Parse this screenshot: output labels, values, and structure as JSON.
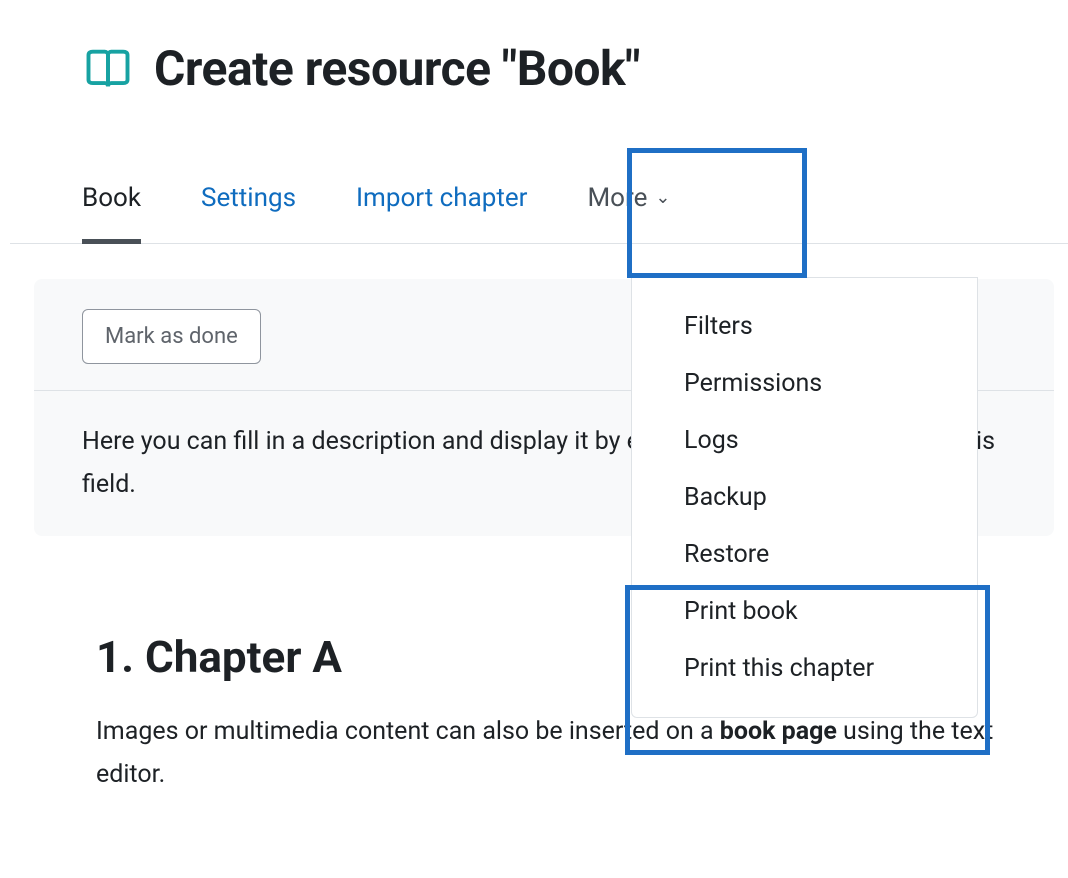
{
  "header": {
    "title": "Create resource \"Book\""
  },
  "tabs": {
    "book": "Book",
    "settings": "Settings",
    "import_chapter": "Import chapter",
    "more": "More"
  },
  "dropdown": {
    "items": [
      "Filters",
      "Permissions",
      "Logs",
      "Backup",
      "Restore",
      "Print book",
      "Print this chapter"
    ]
  },
  "content": {
    "mark_done": "Mark as done",
    "description": "Here you can fill in a description and display it by enabling the checkbox below this field."
  },
  "chapter": {
    "title": "1. Chapter A",
    "text_pre": "Images or multimedia content can also be inserted on a ",
    "bold": "book page",
    "text_post": " using the text editor."
  }
}
